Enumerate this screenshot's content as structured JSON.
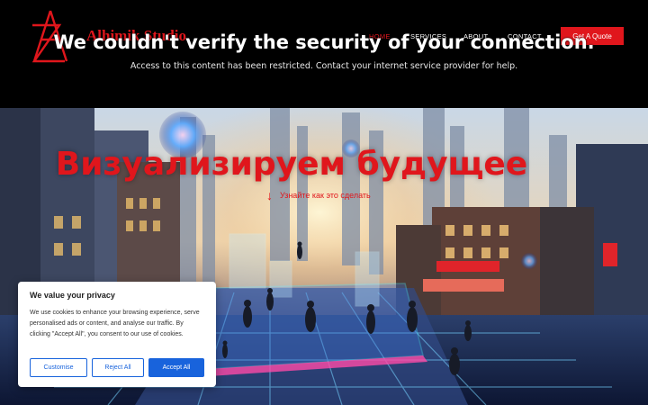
{
  "header": {
    "brand": "Alhimik Studio",
    "nav": [
      {
        "label": "HOME",
        "active": true
      },
      {
        "label": "SERVICES",
        "active": false
      },
      {
        "label": "ABOUT",
        "active": false
      },
      {
        "label": "CONTACT",
        "active": false
      }
    ],
    "cta_label": "Get A Quote"
  },
  "security_notice": {
    "title": "We couldn't verify the security of your connection.",
    "message": "Access to this content has been restricted. Contact your internet service provider for help."
  },
  "hero": {
    "title": "Визуализируем будущее",
    "link_icon": "↓",
    "link_text": "Узнайте как это сделать"
  },
  "cookie": {
    "title": "We value your privacy",
    "text": "We use cookies to enhance your browsing experience, serve personalised ads or content, and analyse our traffic. By clicking \"Accept All\", you consent to our use of cookies.",
    "customise": "Customise",
    "reject": "Reject All",
    "accept": "Accept All"
  },
  "colors": {
    "brand_red": "#e0161c",
    "cookie_blue": "#1863dc"
  },
  "icons": [
    "logo-az-mark",
    "arrow-down-icon"
  ]
}
